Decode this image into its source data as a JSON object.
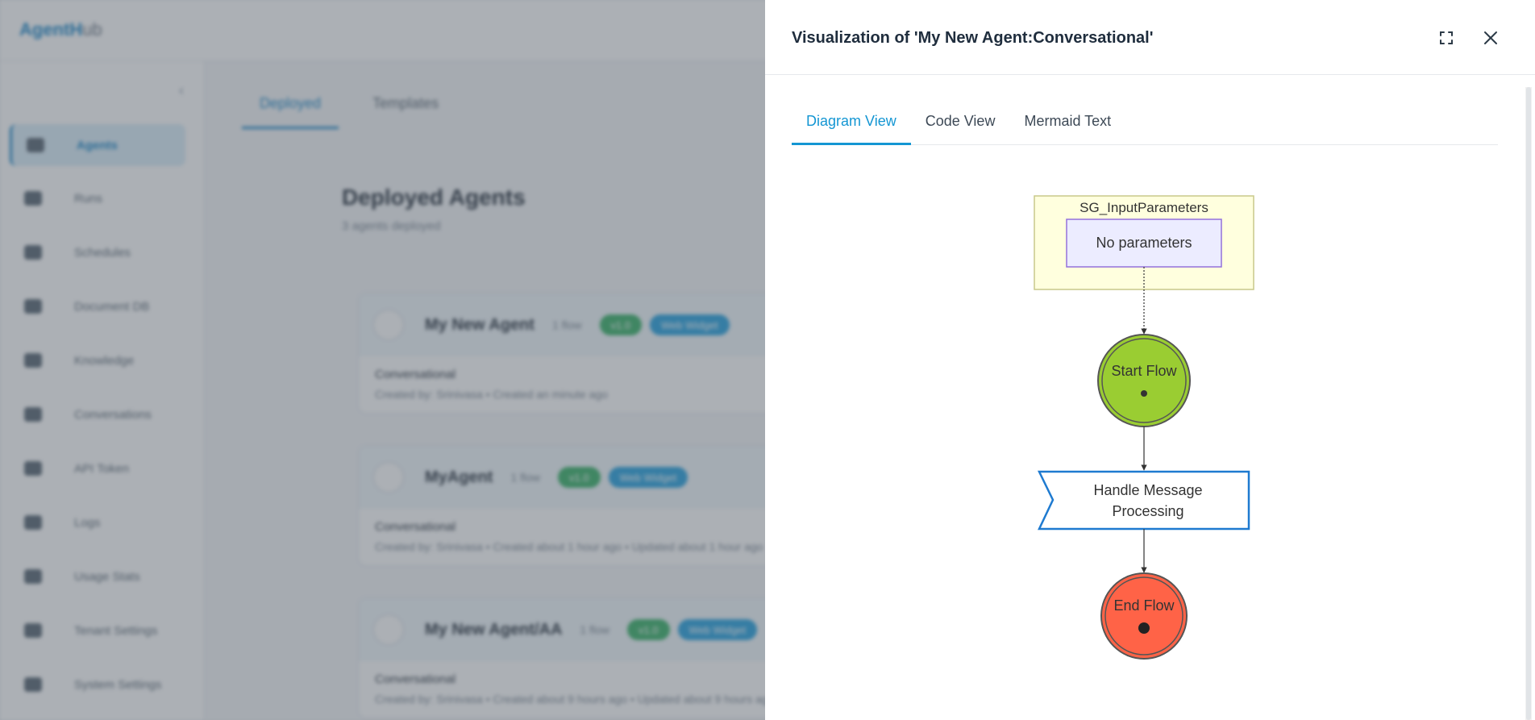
{
  "app": {
    "logo_main": "AgentH",
    "logo_suffix": "ub"
  },
  "sidebar": {
    "items": [
      {
        "label": "Agents",
        "icon": "agents-icon",
        "active": true
      },
      {
        "label": "Runs",
        "icon": "runs-icon"
      },
      {
        "label": "Schedules",
        "icon": "clock-icon"
      },
      {
        "label": "Document DB",
        "icon": "database-icon"
      },
      {
        "label": "Knowledge",
        "icon": "document-icon"
      },
      {
        "label": "Conversations",
        "icon": "search-icon"
      },
      {
        "label": "API Token",
        "icon": "key-icon"
      },
      {
        "label": "Logs",
        "icon": "code-icon"
      },
      {
        "label": "Usage Stats",
        "icon": "chart-icon"
      },
      {
        "label": "Tenant Settings",
        "icon": "settings-icon"
      },
      {
        "label": "System Settings",
        "icon": "gear-icon"
      }
    ]
  },
  "main": {
    "tabs": [
      {
        "label": "Deployed",
        "active": true
      },
      {
        "label": "Templates"
      }
    ],
    "title": "Deployed Agents",
    "subtitle": "3 agents deployed",
    "cards": [
      {
        "name": "My New Agent",
        "flows": "1 flow",
        "badge1": "v1.0",
        "badge2": "Web Widget",
        "type": "Conversational",
        "meta": "Created by: Srinivasa  •  Created an minute ago"
      },
      {
        "name": "MyAgent",
        "flows": "1 flow",
        "badge1": "v1.0",
        "badge2": "Web Widget",
        "type": "Conversational",
        "meta": "Created by: Srinivasa  •  Created about 1 hour ago  •  Updated about 1 hour ago"
      },
      {
        "name": "My New Agent/AA",
        "flows": "1 flow",
        "badge1": "v1.0",
        "badge2": "Web Widget",
        "type": "Conversational",
        "meta": "Created by: Srinivasa  •  Created about 9 hours ago  •  Updated about 9 hours ago"
      }
    ]
  },
  "drawer": {
    "title": "Visualization of 'My New Agent:Conversational'",
    "expand_icon": "expand-icon",
    "close_icon": "close-icon",
    "tabs": [
      {
        "label": "Diagram View",
        "active": true
      },
      {
        "label": "Code View"
      },
      {
        "label": "Mermaid Text"
      }
    ]
  },
  "diagram": {
    "subgraph_label": "SG_InputParameters",
    "param_label": "No parameters",
    "start_label": "Start Flow",
    "process_label_line1": "Handle Message",
    "process_label_line2": "Processing",
    "end_label": "End Flow",
    "colors": {
      "subgraph_fill": "#ffffde",
      "subgraph_stroke": "#c9c98a",
      "param_fill": "#ececff",
      "param_stroke": "#9370db",
      "start_fill": "#9acd32",
      "process_stroke": "#1e7ad0",
      "end_fill": "#ff6347"
    }
  }
}
